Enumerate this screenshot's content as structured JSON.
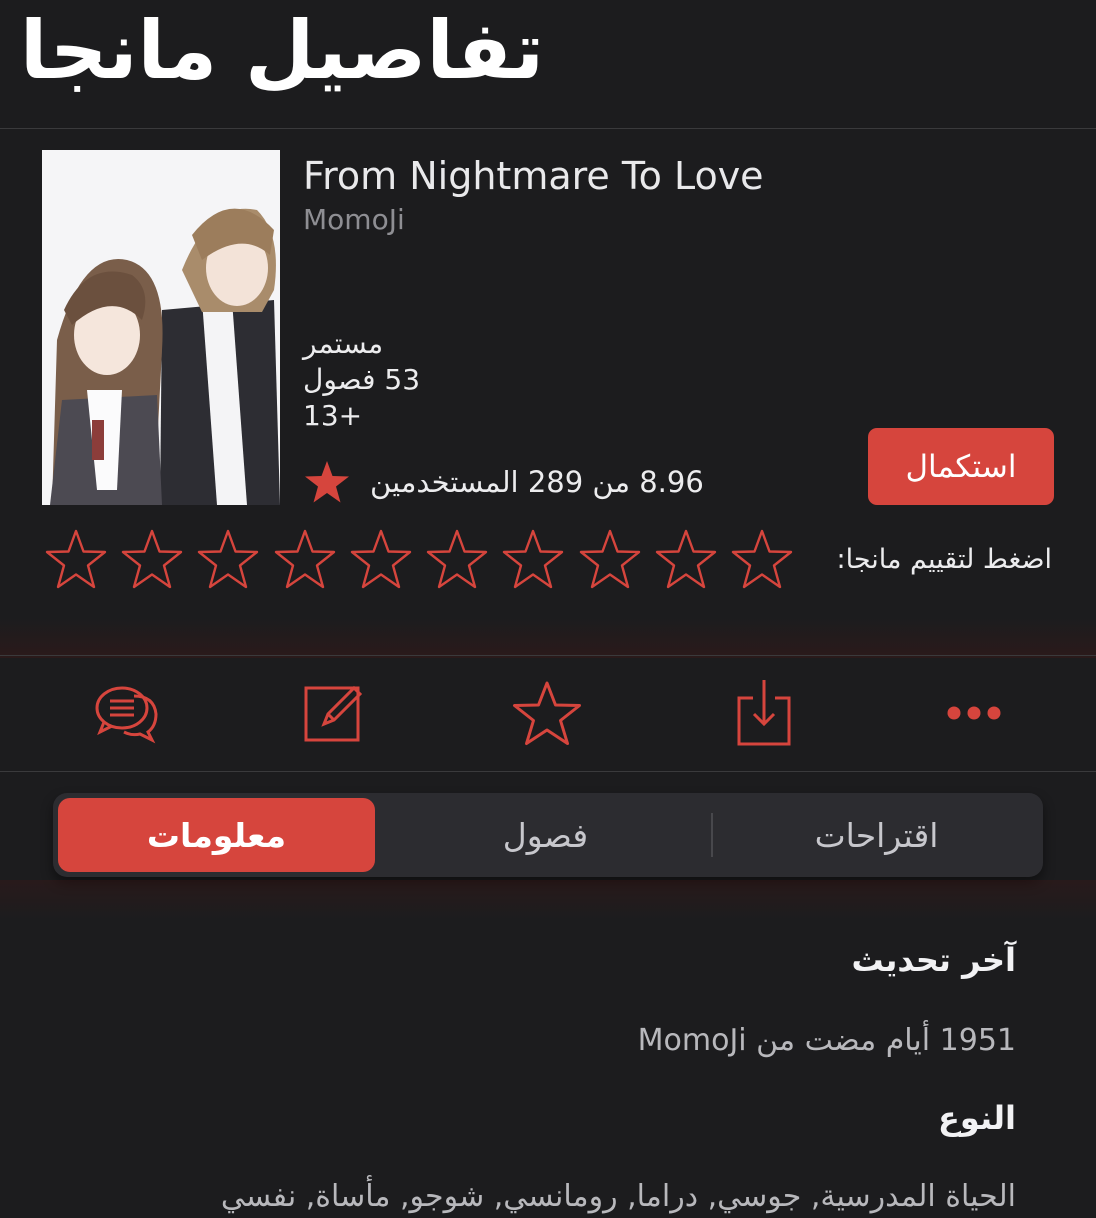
{
  "header": {
    "title": "تفاصيل مانجا"
  },
  "manga": {
    "title": "From Nightmare To Love",
    "author": "MomoJi",
    "status": "مستمر",
    "chapters": "53 فصول",
    "age_rating": "13+",
    "rating_text": "8.96 من 289 المستخدمين",
    "continue_label": "استكمال"
  },
  "rate": {
    "label": "اضغط لتقييم مانجا:",
    "stars": 10
  },
  "actions": [
    "comments-icon",
    "edit-icon",
    "star-outline-icon",
    "download-icon",
    "more-icon"
  ],
  "tabs": [
    {
      "label": "معلومات",
      "active": true
    },
    {
      "label": "فصول",
      "active": false
    },
    {
      "label": "اقتراحات",
      "active": false
    }
  ],
  "info": {
    "last_update_label": "آخر تحديث",
    "last_update_value": "1951 أيام مضت من MomoJi",
    "genre_label": "النوع",
    "genre_value": "الحياة المدرسية, جوسي, دراما, رومانسي, شوجو, مأساة, نفسي"
  },
  "colors": {
    "background": "#1c1c1e",
    "accent": "#d6453d",
    "segment_bg": "#2c2c30"
  }
}
